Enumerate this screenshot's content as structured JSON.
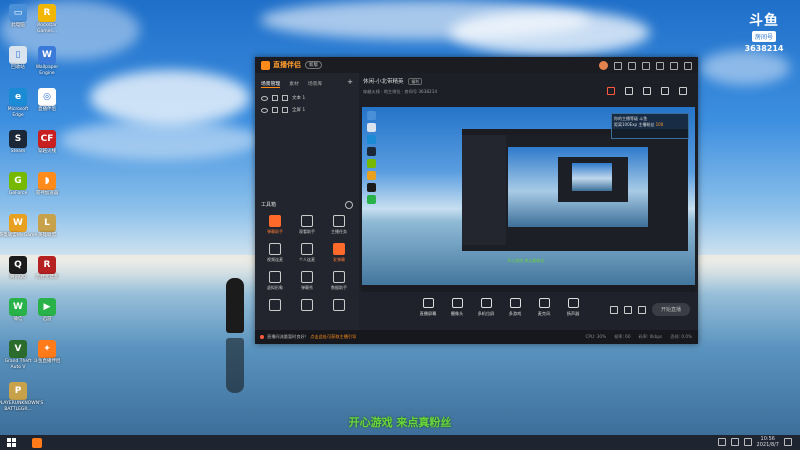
{
  "desktop": {
    "icons_left": [
      {
        "label": "此电脑",
        "color": "#4a90d9",
        "glyph": "▭"
      },
      {
        "label": "回收站",
        "color": "#d9e4ee",
        "glyph": "▯"
      },
      {
        "label": "Microsoft\nEdge",
        "color": "#1c8bd6",
        "glyph": "e"
      },
      {
        "label": "Steam",
        "color": "#1b2838",
        "glyph": "S"
      },
      {
        "label": "GeForce",
        "color": "#76b900",
        "glyph": "G"
      },
      {
        "label": "英雄联盟WeGame",
        "color": "#e8a020",
        "glyph": "W"
      },
      {
        "label": "腾讯QQ",
        "color": "#1b1b1b",
        "glyph": "Q"
      },
      {
        "label": "微信",
        "color": "#2ab24a",
        "glyph": "W"
      },
      {
        "label": "Grand Theft\nAuto V",
        "color": "#2b6b2b",
        "glyph": "V"
      },
      {
        "label": "PLAYERUNKNOWN'S\nBATTLEGR...",
        "color": "#c8a24a",
        "glyph": "P"
      }
    ],
    "icons_second": [
      {
        "label": "Rockstar\nGames...",
        "color": "#f2b705",
        "glyph": "R"
      },
      {
        "label": "Wallpaper\nEngine",
        "color": "#3b7ad9",
        "glyph": "W"
      },
      {
        "label": "直播伴侣",
        "color": "#ffffff",
        "glyph": "◎"
      },
      {
        "label": "穿越火线",
        "color": "#c82020",
        "glyph": "CF"
      },
      {
        "label": "雷神加速器",
        "color": "#ff8c1a",
        "glyph": "◗"
      },
      {
        "label": "英雄联盟",
        "color": "#c8a24a",
        "glyph": "L"
      },
      {
        "label": "荒野大镖客",
        "color": "#b52020",
        "glyph": "R"
      },
      {
        "label": "迅游",
        "color": "#2ab24a",
        "glyph": "▶"
      },
      {
        "label": "斗鱼直播伴侣",
        "color": "#ff7b1a",
        "glyph": "✦"
      }
    ],
    "douyu": {
      "logo": "斗鱼",
      "tag": "房间号",
      "room_number": "3638214"
    },
    "subtitle": "开心游戏 来点真粉丝"
  },
  "app": {
    "name": "直播伴侣",
    "version": "新版",
    "tabs": [
      "场景管理",
      "素材",
      "场景库"
    ],
    "scenes": [
      "文本 1",
      "全屏 1"
    ],
    "tools_header": "工具箱",
    "tools": [
      {
        "label": "弹幕助手",
        "hot": true
      },
      {
        "label": "观看助手",
        "hot": false
      },
      {
        "label": "主播任务",
        "hot": false
      },
      {
        "label": "视频连麦",
        "hot": false
      },
      {
        "label": "个人连麦",
        "hot": false
      },
      {
        "label": "发弹幕",
        "hot": true
      },
      {
        "label": "虚拟形象",
        "hot": false
      },
      {
        "label": "弹幕秀",
        "hot": false
      },
      {
        "label": "数据助手",
        "hot": false
      },
      {
        "label": "",
        "hot": false
      },
      {
        "label": "",
        "hot": false
      },
      {
        "label": "",
        "hot": false
      }
    ],
    "room": {
      "title": "休闲-小北带精英",
      "badge": "福利",
      "meta": "穿越火线 · 地主排位  ·  房间号 3638214"
    },
    "overlay": {
      "line1": "你的主播等级 斗鱼",
      "line2": "距离100Exp 主播粉丝",
      "num": "100"
    },
    "preview_subtitle": "开心游戏 来点真粉丝",
    "bottom_buttons": [
      "直播屏幕",
      "摄像头",
      "多机位屏",
      "多游戏",
      "麦克风",
      "扬声器"
    ],
    "start_label": "开始直播",
    "status_notice": "直播间流量暂时良好！",
    "status_link": "点击此处可获取主播引导",
    "stats": [
      "CPU: 30%",
      "帧率: 60",
      "码率: 0kbps",
      "丢帧: 0.0%"
    ]
  },
  "taskbar": {
    "time": "10:56",
    "date": "2021/8/7"
  }
}
